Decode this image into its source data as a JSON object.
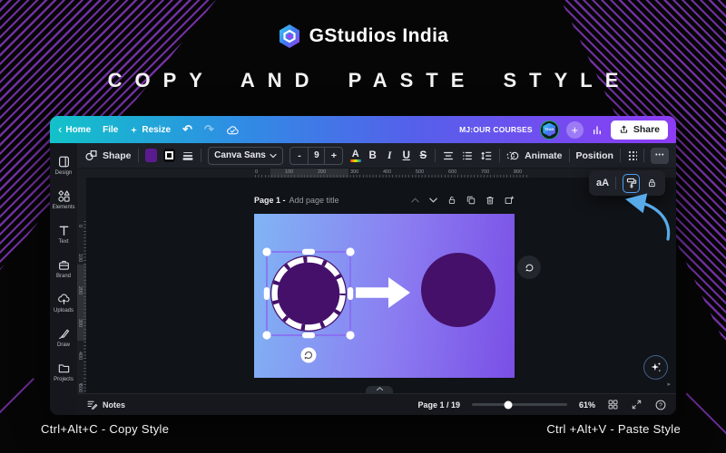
{
  "hero": {
    "brand": "GStudios India",
    "title": "COPY AND PASTE STYLE",
    "footer_left": "Ctrl+Alt+C - Copy Style",
    "footer_right": "Ctrl +Alt+V - Paste Style",
    "stripe_color": "#7130a0"
  },
  "topbar": {
    "home": "Home",
    "file": "File",
    "resize": "Resize",
    "doc_name": "MJ:OUR COURSES",
    "avatar": "TEAM",
    "plus": "+",
    "share": "Share"
  },
  "toolbar": {
    "shape": "Shape",
    "font": "Canva Sans",
    "size_minus": "-",
    "size": "9",
    "size_plus": "+",
    "color_letter": "A",
    "bold": "B",
    "italic": "I",
    "underline": "U",
    "strike": "S",
    "animate": "Animate",
    "position": "Position",
    "more": "•••",
    "fill_swatch_color": "#5a1b8e"
  },
  "style_popup": {
    "aa": "aA"
  },
  "sidebar": {
    "items": [
      {
        "label": "Design"
      },
      {
        "label": "Elements"
      },
      {
        "label": "Text"
      },
      {
        "label": "Brand"
      },
      {
        "label": "Uploads"
      },
      {
        "label": "Draw"
      },
      {
        "label": "Projects"
      }
    ]
  },
  "canvas": {
    "page_label": "Page 1 -",
    "page_title_placeholder": "Add page title",
    "h_ruler": [
      "0",
      "100",
      "200",
      "300",
      "400",
      "500",
      "600",
      "700",
      "800"
    ],
    "v_ruler": [
      "0",
      "100",
      "200",
      "300",
      "400",
      "500"
    ],
    "page_gradient_start": "#80b5f4",
    "page_gradient_end": "#7a4fe6",
    "circle_color": "#45106a",
    "hint_arrow_color": "#58aae9"
  },
  "statusbar": {
    "notes": "Notes",
    "page_indicator": "Page 1 / 19",
    "zoom": "61%"
  }
}
